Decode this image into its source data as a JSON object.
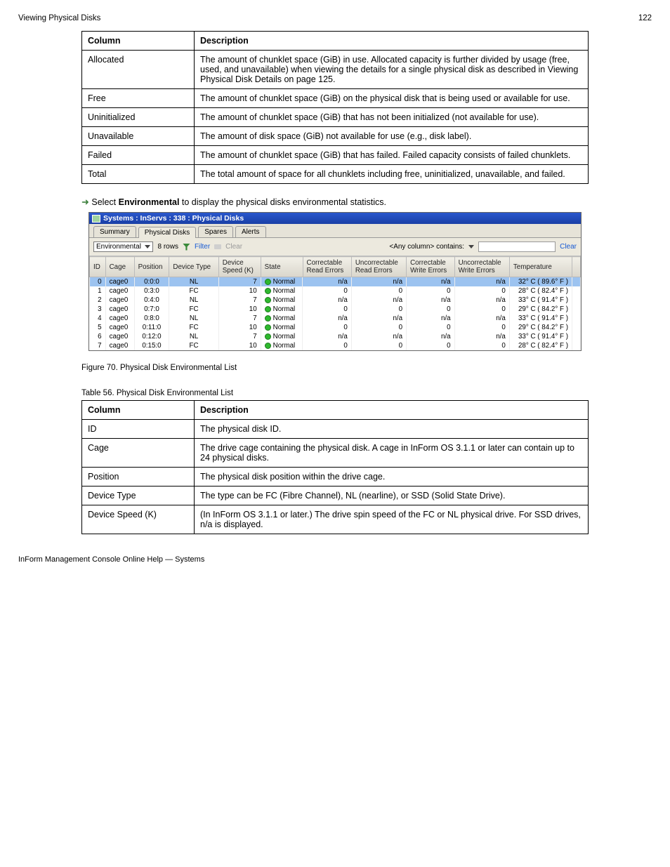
{
  "header": {
    "left_title": "Viewing Physical Disks",
    "page_num": "122"
  },
  "param_tables": {
    "table1": {
      "head": {
        "c0": "Column",
        "c1": "Description"
      },
      "rows": [
        {
          "c0": "Allocated",
          "c1": "The amount of chunklet space (GiB) in use. Allocated capacity is further divided by usage (free, used, and unavailable) when viewing the details for a single physical disk as described in Viewing Physical Disk Details on page 125."
        },
        {
          "c0": "Free",
          "c1": "The amount of chunklet space (GiB) on the physical disk that is being used or available for use."
        },
        {
          "c0": "Uninitialized",
          "c1": "The amount of chunklet space (GiB) that has not been initialized (not available for use)."
        },
        {
          "c0": "Unavailable",
          "c1": "The amount of disk space (GiB) not available for use (e.g., disk label)."
        },
        {
          "c0": "Failed",
          "c1": "The amount of chunklet space (GiB) that has failed. Failed capacity consists of failed chunklets."
        },
        {
          "c0": "Total",
          "c1": "The total amount of space for all chunklets including free, uninitialized, unavailable, and failed."
        }
      ]
    },
    "table2": {
      "head": {
        "c0": "Column",
        "c1": "Description"
      },
      "rows": [
        {
          "c0": "ID",
          "c1": "The physical disk ID."
        },
        {
          "c0": "Cage",
          "c1": "The drive cage containing the physical disk. A cage in InForm OS 3.1.1 or later can contain up to 24 physical disks."
        },
        {
          "c0": "Position",
          "c1": "The physical disk position within the drive cage."
        },
        {
          "c0": "Device Type",
          "c1": "The type can be FC (Fibre Channel), NL (nearline), or SSD (Solid State Drive)."
        },
        {
          "c0": "Device Speed (K)",
          "c1": "(In InForm OS 3.1.1 or later.) The drive spin speed of the FC or NL physical drive. For SSD drives, n/a is displayed."
        }
      ]
    }
  },
  "env_note": {
    "bullet_sym": "➜",
    "text_prefix": "Select ",
    "text_bold": "Environmental",
    "text_suffix": " to display the physical disks environmental statistics."
  },
  "screenshot": {
    "title": "Systems : InServs : 338 : Physical Disks",
    "tabs": [
      "Summary",
      "Physical Disks",
      "Spares",
      "Alerts"
    ],
    "active_tab_idx": 1,
    "toolbar": {
      "select_value": "Environmental",
      "rows_text": "8 rows",
      "filter_label": "Filter",
      "clear_label": "Clear",
      "filter_cond_text": "<Any column> contains:",
      "clear_right": "Clear",
      "search_placeholder": ""
    },
    "columns": [
      {
        "lbl": "ID"
      },
      {
        "lbl": "Cage"
      },
      {
        "lbl": "Position"
      },
      {
        "lbl": "Device Type"
      },
      {
        "lbl": "Device",
        "sub": "Speed (K)"
      },
      {
        "lbl": "State"
      },
      {
        "lbl": "Correctable",
        "sub": "Read Errors"
      },
      {
        "lbl": "Uncorrectable",
        "sub": "Read Errors"
      },
      {
        "lbl": "Correctable",
        "sub": "Write Errors"
      },
      {
        "lbl": "Uncorrectable",
        "sub": "Write Errors"
      },
      {
        "lbl": "Temperature"
      },
      {
        "lbl": ""
      }
    ],
    "rows": [
      {
        "id": "0",
        "cage": "cage0",
        "pos": "0:0:0",
        "dtype": "NL",
        "speed": "7",
        "state": "Normal",
        "cre": "n/a",
        "ure": "n/a",
        "cwe": "n/a",
        "uwe": "n/a",
        "temp": "32° C ( 89.6° F )",
        "sel": true
      },
      {
        "id": "1",
        "cage": "cage0",
        "pos": "0:3:0",
        "dtype": "FC",
        "speed": "10",
        "state": "Normal",
        "cre": "0",
        "ure": "0",
        "cwe": "0",
        "uwe": "0",
        "temp": "28° C ( 82.4° F )"
      },
      {
        "id": "2",
        "cage": "cage0",
        "pos": "0:4:0",
        "dtype": "NL",
        "speed": "7",
        "state": "Normal",
        "cre": "n/a",
        "ure": "n/a",
        "cwe": "n/a",
        "uwe": "n/a",
        "temp": "33° C ( 91.4° F )"
      },
      {
        "id": "3",
        "cage": "cage0",
        "pos": "0:7:0",
        "dtype": "FC",
        "speed": "10",
        "state": "Normal",
        "cre": "0",
        "ure": "0",
        "cwe": "0",
        "uwe": "0",
        "temp": "29° C ( 84.2° F )"
      },
      {
        "id": "4",
        "cage": "cage0",
        "pos": "0:8:0",
        "dtype": "NL",
        "speed": "7",
        "state": "Normal",
        "cre": "n/a",
        "ure": "n/a",
        "cwe": "n/a",
        "uwe": "n/a",
        "temp": "33° C ( 91.4° F )"
      },
      {
        "id": "5",
        "cage": "cage0",
        "pos": "0:11:0",
        "dtype": "FC",
        "speed": "10",
        "state": "Normal",
        "cre": "0",
        "ure": "0",
        "cwe": "0",
        "uwe": "0",
        "temp": "29° C ( 84.2° F )"
      },
      {
        "id": "6",
        "cage": "cage0",
        "pos": "0:12:0",
        "dtype": "NL",
        "speed": "7",
        "state": "Normal",
        "cre": "n/a",
        "ure": "n/a",
        "cwe": "n/a",
        "uwe": "n/a",
        "temp": "33° C ( 91.4° F )"
      },
      {
        "id": "7",
        "cage": "cage0",
        "pos": "0:15:0",
        "dtype": "FC",
        "speed": "10",
        "state": "Normal",
        "cre": "0",
        "ure": "0",
        "cwe": "0",
        "uwe": "0",
        "temp": "28° C ( 82.4° F )"
      }
    ]
  },
  "fig_captions": {
    "fig1": "Figure 70. Physical Disk Environmental List",
    "tbl_caption": "Table 56. Physical Disk Environmental List"
  },
  "footer_text": "InForm Management Console Online Help — Systems"
}
